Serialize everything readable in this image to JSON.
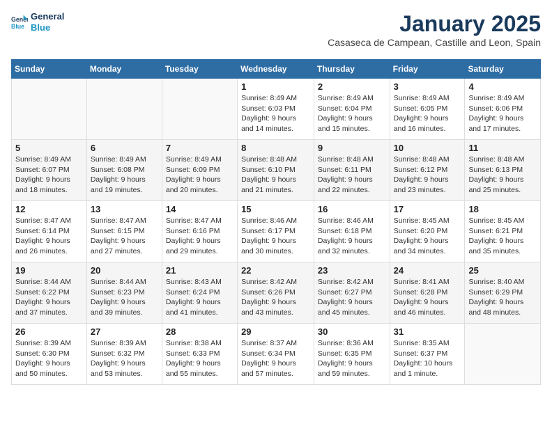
{
  "logo": {
    "general": "General",
    "blue": "Blue"
  },
  "header": {
    "title": "January 2025",
    "subtitle": "Casaseca de Campean, Castille and Leon, Spain"
  },
  "weekdays": [
    "Sunday",
    "Monday",
    "Tuesday",
    "Wednesday",
    "Thursday",
    "Friday",
    "Saturday"
  ],
  "weeks": [
    [
      {
        "day": "",
        "sunrise": "",
        "sunset": "",
        "daylight": ""
      },
      {
        "day": "",
        "sunrise": "",
        "sunset": "",
        "daylight": ""
      },
      {
        "day": "",
        "sunrise": "",
        "sunset": "",
        "daylight": ""
      },
      {
        "day": "1",
        "sunrise": "Sunrise: 8:49 AM",
        "sunset": "Sunset: 6:03 PM",
        "daylight": "Daylight: 9 hours and 14 minutes."
      },
      {
        "day": "2",
        "sunrise": "Sunrise: 8:49 AM",
        "sunset": "Sunset: 6:04 PM",
        "daylight": "Daylight: 9 hours and 15 minutes."
      },
      {
        "day": "3",
        "sunrise": "Sunrise: 8:49 AM",
        "sunset": "Sunset: 6:05 PM",
        "daylight": "Daylight: 9 hours and 16 minutes."
      },
      {
        "day": "4",
        "sunrise": "Sunrise: 8:49 AM",
        "sunset": "Sunset: 6:06 PM",
        "daylight": "Daylight: 9 hours and 17 minutes."
      }
    ],
    [
      {
        "day": "5",
        "sunrise": "Sunrise: 8:49 AM",
        "sunset": "Sunset: 6:07 PM",
        "daylight": "Daylight: 9 hours and 18 minutes."
      },
      {
        "day": "6",
        "sunrise": "Sunrise: 8:49 AM",
        "sunset": "Sunset: 6:08 PM",
        "daylight": "Daylight: 9 hours and 19 minutes."
      },
      {
        "day": "7",
        "sunrise": "Sunrise: 8:49 AM",
        "sunset": "Sunset: 6:09 PM",
        "daylight": "Daylight: 9 hours and 20 minutes."
      },
      {
        "day": "8",
        "sunrise": "Sunrise: 8:48 AM",
        "sunset": "Sunset: 6:10 PM",
        "daylight": "Daylight: 9 hours and 21 minutes."
      },
      {
        "day": "9",
        "sunrise": "Sunrise: 8:48 AM",
        "sunset": "Sunset: 6:11 PM",
        "daylight": "Daylight: 9 hours and 22 minutes."
      },
      {
        "day": "10",
        "sunrise": "Sunrise: 8:48 AM",
        "sunset": "Sunset: 6:12 PM",
        "daylight": "Daylight: 9 hours and 23 minutes."
      },
      {
        "day": "11",
        "sunrise": "Sunrise: 8:48 AM",
        "sunset": "Sunset: 6:13 PM",
        "daylight": "Daylight: 9 hours and 25 minutes."
      }
    ],
    [
      {
        "day": "12",
        "sunrise": "Sunrise: 8:47 AM",
        "sunset": "Sunset: 6:14 PM",
        "daylight": "Daylight: 9 hours and 26 minutes."
      },
      {
        "day": "13",
        "sunrise": "Sunrise: 8:47 AM",
        "sunset": "Sunset: 6:15 PM",
        "daylight": "Daylight: 9 hours and 27 minutes."
      },
      {
        "day": "14",
        "sunrise": "Sunrise: 8:47 AM",
        "sunset": "Sunset: 6:16 PM",
        "daylight": "Daylight: 9 hours and 29 minutes."
      },
      {
        "day": "15",
        "sunrise": "Sunrise: 8:46 AM",
        "sunset": "Sunset: 6:17 PM",
        "daylight": "Daylight: 9 hours and 30 minutes."
      },
      {
        "day": "16",
        "sunrise": "Sunrise: 8:46 AM",
        "sunset": "Sunset: 6:18 PM",
        "daylight": "Daylight: 9 hours and 32 minutes."
      },
      {
        "day": "17",
        "sunrise": "Sunrise: 8:45 AM",
        "sunset": "Sunset: 6:20 PM",
        "daylight": "Daylight: 9 hours and 34 minutes."
      },
      {
        "day": "18",
        "sunrise": "Sunrise: 8:45 AM",
        "sunset": "Sunset: 6:21 PM",
        "daylight": "Daylight: 9 hours and 35 minutes."
      }
    ],
    [
      {
        "day": "19",
        "sunrise": "Sunrise: 8:44 AM",
        "sunset": "Sunset: 6:22 PM",
        "daylight": "Daylight: 9 hours and 37 minutes."
      },
      {
        "day": "20",
        "sunrise": "Sunrise: 8:44 AM",
        "sunset": "Sunset: 6:23 PM",
        "daylight": "Daylight: 9 hours and 39 minutes."
      },
      {
        "day": "21",
        "sunrise": "Sunrise: 8:43 AM",
        "sunset": "Sunset: 6:24 PM",
        "daylight": "Daylight: 9 hours and 41 minutes."
      },
      {
        "day": "22",
        "sunrise": "Sunrise: 8:42 AM",
        "sunset": "Sunset: 6:26 PM",
        "daylight": "Daylight: 9 hours and 43 minutes."
      },
      {
        "day": "23",
        "sunrise": "Sunrise: 8:42 AM",
        "sunset": "Sunset: 6:27 PM",
        "daylight": "Daylight: 9 hours and 45 minutes."
      },
      {
        "day": "24",
        "sunrise": "Sunrise: 8:41 AM",
        "sunset": "Sunset: 6:28 PM",
        "daylight": "Daylight: 9 hours and 46 minutes."
      },
      {
        "day": "25",
        "sunrise": "Sunrise: 8:40 AM",
        "sunset": "Sunset: 6:29 PM",
        "daylight": "Daylight: 9 hours and 48 minutes."
      }
    ],
    [
      {
        "day": "26",
        "sunrise": "Sunrise: 8:39 AM",
        "sunset": "Sunset: 6:30 PM",
        "daylight": "Daylight: 9 hours and 50 minutes."
      },
      {
        "day": "27",
        "sunrise": "Sunrise: 8:39 AM",
        "sunset": "Sunset: 6:32 PM",
        "daylight": "Daylight: 9 hours and 53 minutes."
      },
      {
        "day": "28",
        "sunrise": "Sunrise: 8:38 AM",
        "sunset": "Sunset: 6:33 PM",
        "daylight": "Daylight: 9 hours and 55 minutes."
      },
      {
        "day": "29",
        "sunrise": "Sunrise: 8:37 AM",
        "sunset": "Sunset: 6:34 PM",
        "daylight": "Daylight: 9 hours and 57 minutes."
      },
      {
        "day": "30",
        "sunrise": "Sunrise: 8:36 AM",
        "sunset": "Sunset: 6:35 PM",
        "daylight": "Daylight: 9 hours and 59 minutes."
      },
      {
        "day": "31",
        "sunrise": "Sunrise: 8:35 AM",
        "sunset": "Sunset: 6:37 PM",
        "daylight": "Daylight: 10 hours and 1 minute."
      },
      {
        "day": "",
        "sunrise": "",
        "sunset": "",
        "daylight": ""
      }
    ]
  ]
}
